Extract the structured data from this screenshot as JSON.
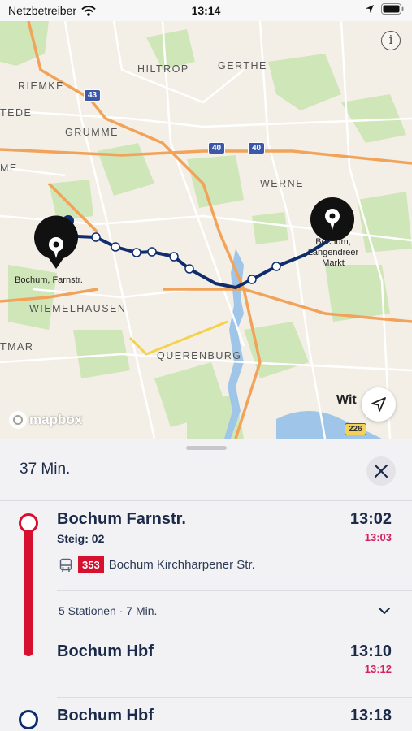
{
  "status_bar": {
    "carrier": "Netzbetreiber",
    "time": "13:14"
  },
  "map": {
    "labels": {
      "hiltrop": "HILTROP",
      "gerthe": "GERTHE",
      "riemke": "RIEMKE",
      "tede": "TEDE",
      "grumme": "GRUMME",
      "me": "ME",
      "werne": "WERNE",
      "wiemelhausen": "WIEMELHAUSEN",
      "tmar": "TMAR",
      "querenburg": "QUERENBURG",
      "wit": "Wit"
    },
    "shields": {
      "a43": "43",
      "a40_1": "40",
      "a40_2": "40",
      "b226": "226"
    },
    "origin_label": "Bochum, Farnstr.",
    "destination_label_1": "Bochum,",
    "destination_label_2": "Langendreer",
    "destination_label_3": "Markt",
    "attribution": "mapbox",
    "info_icon": "info-icon",
    "locate_icon": "location-arrow-icon"
  },
  "sheet": {
    "duration": "37 Min.",
    "close_icon": "close-icon",
    "segments": [
      {
        "from": {
          "name": "Bochum Farnstr.",
          "platform": "Steig: 02",
          "scheduled": "13:02",
          "realtime": "13:03"
        },
        "line": {
          "mode_icon": "bus-icon",
          "number": "353",
          "direction": "Bochum Kirchharpener Str."
        },
        "stations_summary": "5 Stationen · 7 Min.",
        "to": {
          "name": "Bochum Hbf",
          "scheduled": "13:10",
          "realtime": "13:12"
        }
      },
      {
        "from": {
          "name": "Bochum Hbf",
          "scheduled": "13:18"
        }
      }
    ]
  },
  "colors": {
    "line_red": "#d6102f",
    "realtime_pink": "#d6205a",
    "navy": "#1c2a4a",
    "route_blue": "#0f2d6e"
  }
}
